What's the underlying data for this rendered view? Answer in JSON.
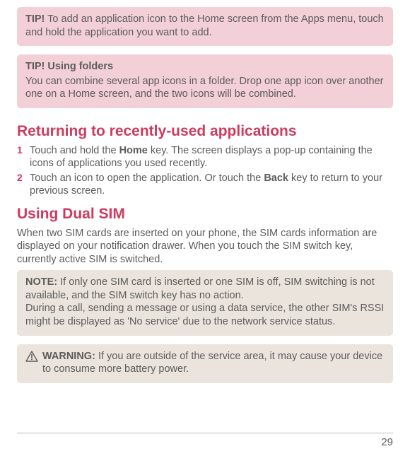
{
  "tip1": {
    "label": "TIP!",
    "text": " To add an application icon to the Home screen from the Apps menu, touch and hold the application you want to add."
  },
  "tip2": {
    "title": "TIP! Using folders",
    "text": "You can combine several app icons in a folder. Drop one app icon over another one on a Home screen, and the two icons will be combined."
  },
  "section1": {
    "heading": "Returning to recently-used applications",
    "steps": [
      {
        "num": "1",
        "pre": "Touch and hold the ",
        "bold": "Home",
        "post": " key. The screen displays a pop-up containing the icons of applications you used recently."
      },
      {
        "num": "2",
        "pre": "Touch an icon to open the application. Or touch the ",
        "bold": "Back",
        "post": " key to return to your previous screen."
      }
    ]
  },
  "section2": {
    "heading": "Using Dual SIM",
    "body": "When two SIM cards are inserted on your phone, the SIM cards information are displayed on your notification drawer. When you touch the SIM switch key, currently active SIM is switched."
  },
  "note": {
    "label": "NOTE:",
    "text1": " If only one SIM card is inserted or one SIM is off, SIM switching is not available, and the SIM switch key has no action.",
    "text2": "During a call, sending a message or using a data service, the other SIM's RSSI might be displayed as 'No service' due to the network service status."
  },
  "warning": {
    "label": "WARNING:",
    "text": " If you are outside of the service area, it may cause your device to consume more battery power."
  },
  "page": "29"
}
